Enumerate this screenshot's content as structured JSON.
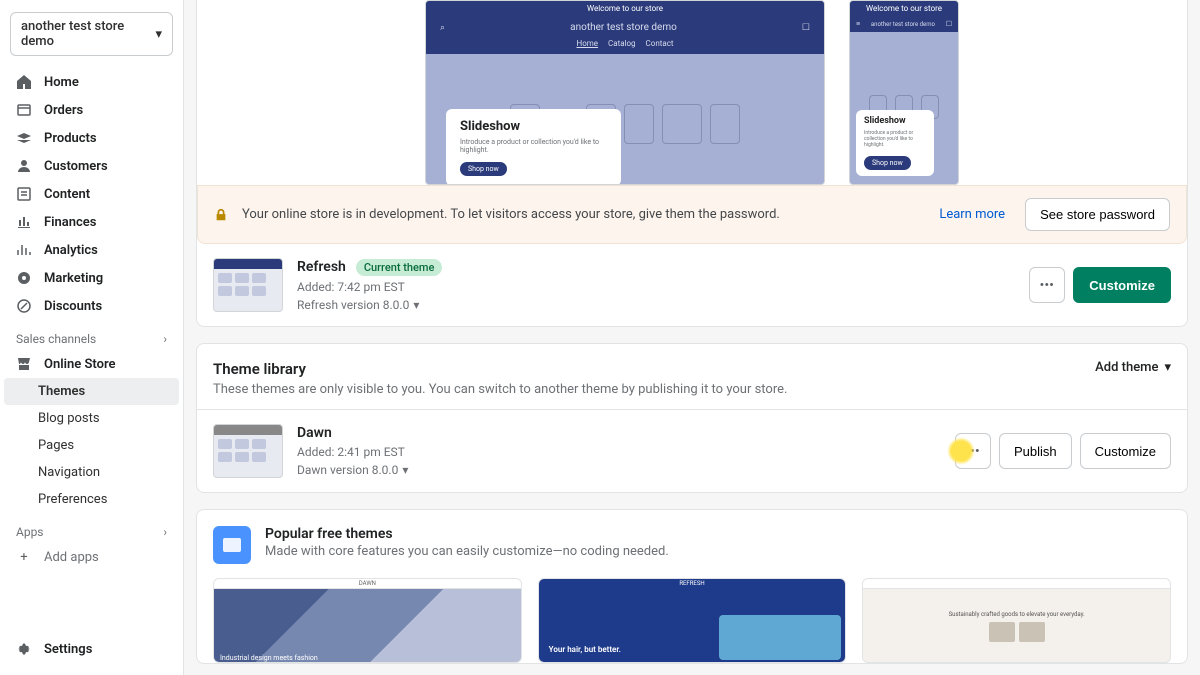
{
  "storeSelector": {
    "label": "another test store demo"
  },
  "nav": {
    "items": [
      {
        "label": "Home"
      },
      {
        "label": "Orders"
      },
      {
        "label": "Products"
      },
      {
        "label": "Customers"
      },
      {
        "label": "Content"
      },
      {
        "label": "Finances"
      },
      {
        "label": "Analytics"
      },
      {
        "label": "Marketing"
      },
      {
        "label": "Discounts"
      }
    ],
    "salesChannelsHeader": "Sales channels",
    "onlineStore": "Online Store",
    "onlineStoreSub": [
      {
        "label": "Themes",
        "active": true
      },
      {
        "label": "Blog posts"
      },
      {
        "label": "Pages"
      },
      {
        "label": "Navigation"
      },
      {
        "label": "Preferences"
      }
    ],
    "appsHeader": "Apps",
    "addApps": "Add apps",
    "settings": "Settings"
  },
  "preview": {
    "banner": "Welcome to our store",
    "storeName": "another test store demo",
    "navItems": [
      "Home",
      "Catalog",
      "Contact"
    ],
    "cardTitle": "Slideshow",
    "cardText": "Introduce a product or collection you'd like to highlight.",
    "cardBtn": "Shop now"
  },
  "alert": {
    "message": "Your online store is in development. To let visitors access your store, give them the password.",
    "learnMore": "Learn more",
    "seePassword": "See store password"
  },
  "currentTheme": {
    "name": "Refresh",
    "badge": "Current theme",
    "added": "Added: 7:42 pm EST",
    "version": "Refresh version 8.0.0",
    "customize": "Customize"
  },
  "library": {
    "title": "Theme library",
    "sub": "These themes are only visible to you. You can switch to another theme by publishing it to your store.",
    "addTheme": "Add theme",
    "items": [
      {
        "name": "Dawn",
        "added": "Added: 2:41 pm EST",
        "version": "Dawn version 8.0.0"
      }
    ],
    "publish": "Publish",
    "customize": "Customize"
  },
  "popular": {
    "title": "Popular free themes",
    "sub": "Made with core features you can easily customize—no coding needed.",
    "dawnLabel": "DAWN",
    "refreshLabel": "REFRESH",
    "dawnTagline": "Industrial design meets fashion",
    "refreshTagline": "Your hair, but better.",
    "craftTagline": "Sustainably crafted goods to elevate your everyday."
  }
}
